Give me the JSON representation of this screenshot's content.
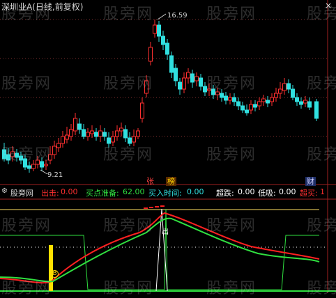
{
  "window": {
    "title": "深圳业A(日线,前复权)",
    "close_icon": "×"
  },
  "price_panel": {
    "high_label": "16.59",
    "low_label": "9.21",
    "tags": {
      "zhang": "张",
      "bang": "榜",
      "cai": "财"
    },
    "colors": {
      "up": "#ff3030",
      "down": "#30e0e0"
    }
  },
  "indicator": {
    "name": "股旁网",
    "chuji_label": "出击:",
    "chuji_value": "0.00",
    "maidian_label": "买点准备:",
    "maidian_value": "62.00",
    "mairu_label": "买入时间:",
    "mairu_value": "0.00",
    "chaodie_label": "超跌:",
    "chaodie_value": "0.00",
    "dixi_label": "低吸:",
    "dixi_value": "0.00",
    "chaomai_label": "超买:",
    "chaomai_value": "1",
    "marker_buy": "B",
    "marker_out": "出"
  },
  "watermark": "股旁网"
}
